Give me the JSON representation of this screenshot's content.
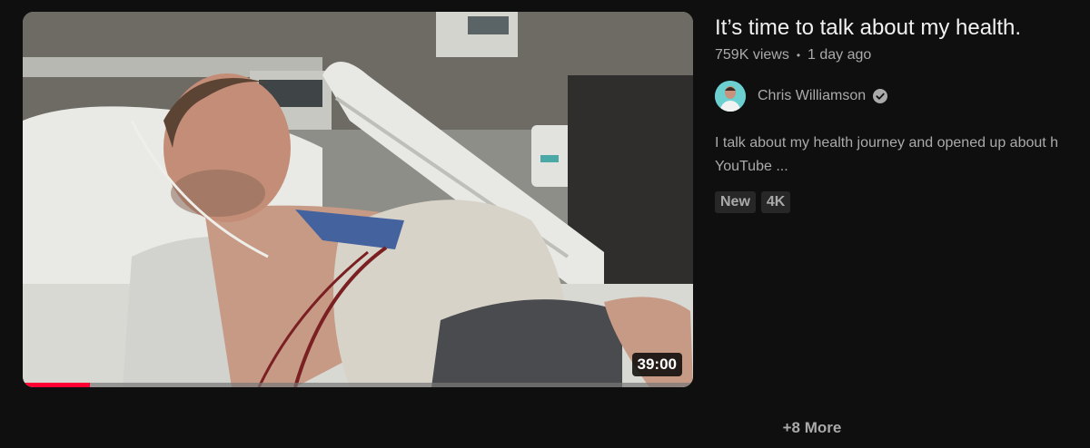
{
  "video": {
    "title": "It’s time to talk about my health.",
    "views": "759K views",
    "separator": "•",
    "age": "1 day ago",
    "duration": "39:00",
    "watch_progress_percent": 10,
    "thumbnail_icon": "hospital-bed-photo"
  },
  "channel": {
    "name": "Chris Williamson",
    "verified_icon": "verified-check-icon"
  },
  "description": "I talk about my health journey and opened up about h YouTube ...",
  "badges": [
    "New",
    "4K"
  ],
  "more_link": "+8 More",
  "colors": {
    "background": "#0f0f0f",
    "text_primary": "#f1f1f1",
    "text_secondary": "#aaaaaa",
    "badge_bg": "#272727",
    "progress_red": "#ff0033"
  }
}
